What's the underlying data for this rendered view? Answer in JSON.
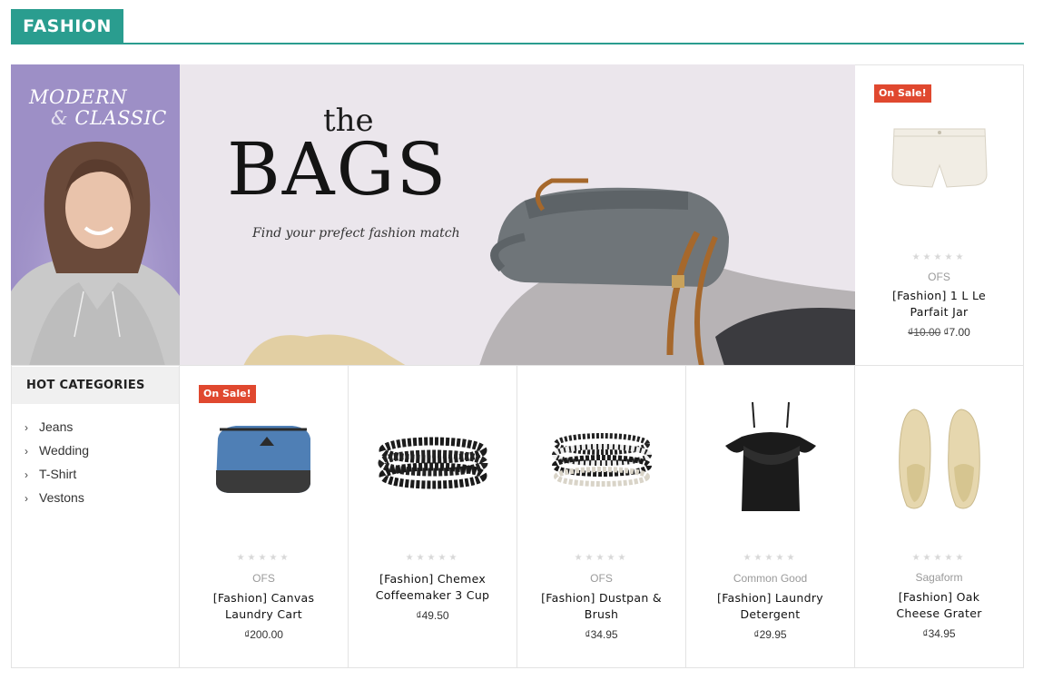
{
  "section": {
    "title": "FASHION"
  },
  "promo_left": {
    "line1": "MODERN",
    "line2_amp": "&",
    "line2": "CLASSIC"
  },
  "banner": {
    "the": "the",
    "bags": "BAGS",
    "tagline": "Find your prefect fashion match"
  },
  "featured": {
    "badge": "On Sale!",
    "stars": "★★★★★",
    "brand": "OFS",
    "name_line1": "[Fashion] 1 L Le",
    "name_line2": "Parfait Jar",
    "old_price": "₫10.00",
    "price": "₫7.00"
  },
  "hot_categories": {
    "title": "HOT CATEGORIES",
    "items": [
      {
        "label": "Jeans"
      },
      {
        "label": "Wedding"
      },
      {
        "label": "T-Shirt"
      },
      {
        "label": "Vestons"
      }
    ]
  },
  "products": [
    {
      "badge": "On Sale!",
      "stars": "★★★★★",
      "brand": "OFS",
      "name_line1": "[Fashion] Canvas",
      "name_line2": "Laundry Cart",
      "price": "₫200.00"
    },
    {
      "stars": "★★★★★",
      "brand": "",
      "name_line1": "[Fashion] Chemex",
      "name_line2": "Coffeemaker 3 Cup",
      "price": "₫49.50"
    },
    {
      "stars": "★★★★★",
      "brand": "OFS",
      "name_line1": "[Fashion] Dustpan &",
      "name_line2": "Brush",
      "price": "₫34.95"
    },
    {
      "stars": "★★★★★",
      "brand": "Common Good",
      "name_line1": "[Fashion] Laundry",
      "name_line2": "Detergent",
      "price": "₫29.95"
    },
    {
      "stars": "★★★★★",
      "brand": "Sagaform",
      "name_line1": "[Fashion] Oak",
      "name_line2": "Cheese Grater",
      "price": "₫34.95"
    }
  ],
  "colors": {
    "accent": "#2a9d8f",
    "sale": "#e0482f",
    "promo_bg": "#9d8fc6",
    "banner_bg": "#ebe6ec"
  }
}
